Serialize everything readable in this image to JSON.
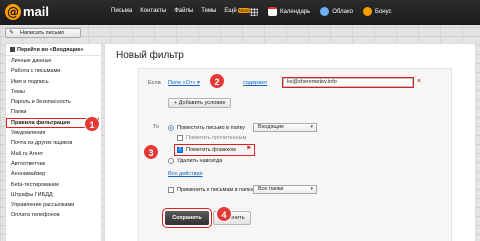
{
  "topbar": {
    "logo_symbol": "@",
    "logo_text": "mail",
    "nav": [
      "Письма",
      "Контакты",
      "Файлы",
      "Темы",
      "Ещё"
    ],
    "more_badge": "NEW",
    "apps": [
      {
        "label": "Календарь",
        "icon": "calendar-icon"
      },
      {
        "label": "Облако",
        "icon": "cloud-icon"
      },
      {
        "label": "Бонус",
        "icon": "bonus-icon"
      }
    ]
  },
  "compose": {
    "label": "Написать письмо"
  },
  "sidebar": {
    "back": "Перейти во «Входящие»",
    "items": [
      "Личные данные",
      "Работа с письмами",
      "Имя и подпись",
      "Темы",
      "Пароль и безопасность",
      "Папки",
      "Правила фильтрации",
      "Уведомления",
      "Почта из других ящиков",
      "Mail.ru Агент",
      "Автоответчик",
      "Анонимайзер",
      "Беta-тестирование",
      "Штрафы ГИБДД",
      "Управление рассылками",
      "Оплата телефонов"
    ],
    "active_index": 6
  },
  "main": {
    "title": "Новый фильтр",
    "if_label": "Если",
    "field_select": "Поле «От»",
    "condition_link": "содержит",
    "condition_value": "ks@sheremetev.info",
    "add_condition": "+ Добавить условие",
    "then_label": "То",
    "move_option": "Поместить письмо в папку",
    "folder_select": "Входящие",
    "mark_read": "Пометить прочитанным",
    "flag_option": "Пометить флажком",
    "delete_option": "Удалить навсегда",
    "all_actions": "Все действия",
    "apply_option": "Применить к письмам в папках",
    "apply_select": "Все папки",
    "save": "Сохранить",
    "cancel": "Отменить"
  },
  "markers": [
    "1",
    "2",
    "3",
    "4"
  ],
  "colors": {
    "accent": "#ff9e00",
    "annotation": "#e53935",
    "link": "#1565c0",
    "primary_button": "#303030"
  }
}
